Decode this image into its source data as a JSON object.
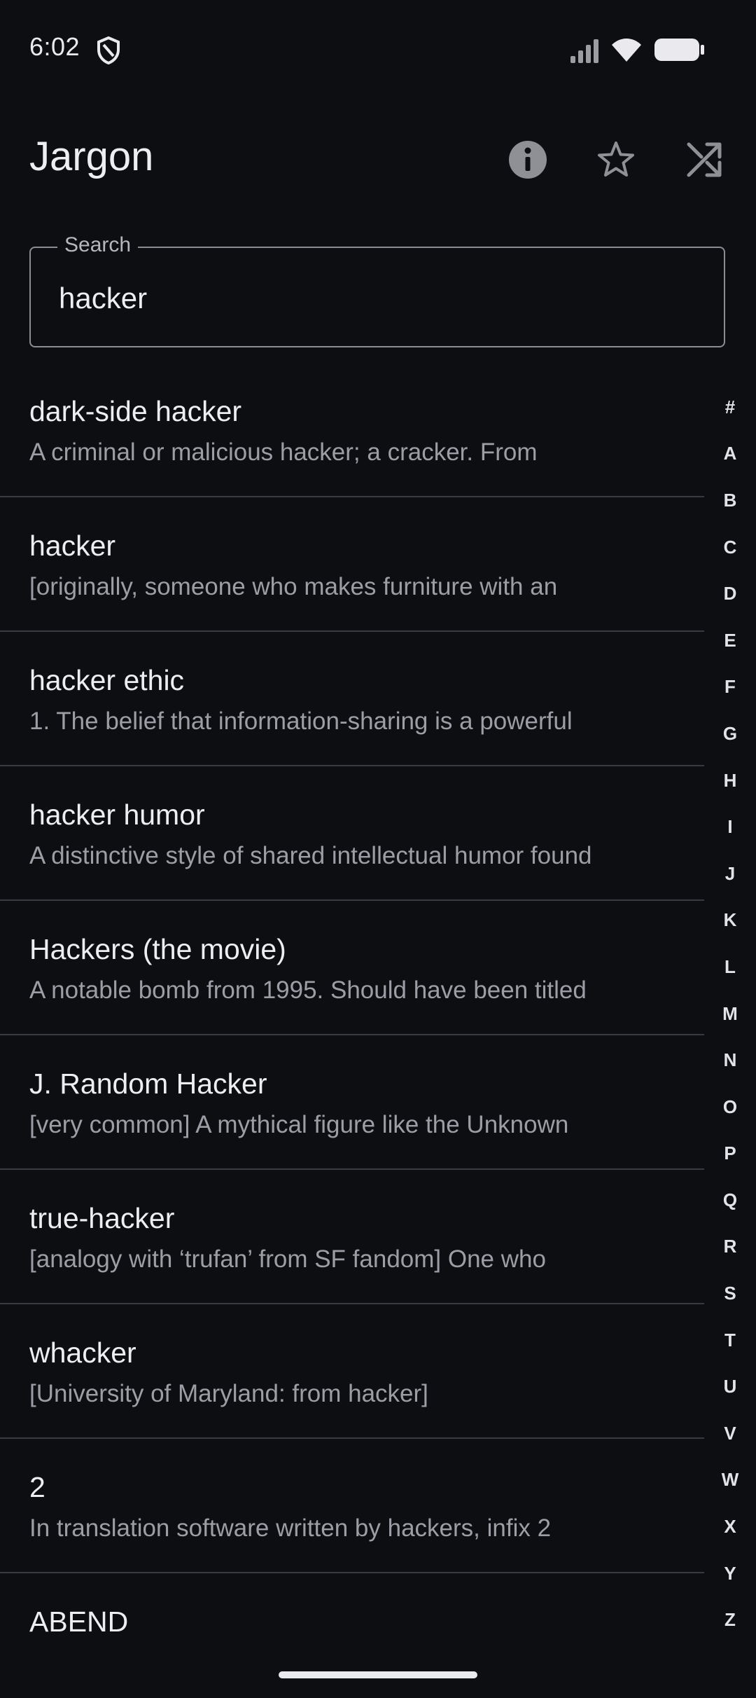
{
  "status_bar": {
    "time": "6:02",
    "icons": [
      "vpn-shield-icon",
      "cellular-signal-icon",
      "wifi-icon",
      "battery-icon"
    ]
  },
  "app_bar": {
    "title": "Jargon",
    "actions": [
      "info-icon",
      "star-outline-icon",
      "shuffle-icon"
    ]
  },
  "search": {
    "label": "Search",
    "value": "hacker"
  },
  "results": [
    {
      "term": "dark-side hacker",
      "snippet": "A criminal or malicious hacker; a cracker. From"
    },
    {
      "term": "hacker",
      "snippet": "[originally, someone who makes furniture with an"
    },
    {
      "term": "hacker ethic",
      "snippet": "1. The belief that information-sharing is a powerful"
    },
    {
      "term": "hacker humor",
      "snippet": "A distinctive style of shared intellectual humor found"
    },
    {
      "term": "Hackers (the movie)",
      "snippet": "A notable bomb from 1995. Should have been titled"
    },
    {
      "term": "J. Random Hacker",
      "snippet": "[very common] A mythical figure like the Unknown"
    },
    {
      "term": "true-hacker",
      "snippet": "[analogy with ‘trufan’ from SF fandom] One who"
    },
    {
      "term": "whacker",
      "snippet": "[University of Maryland: from hacker]"
    },
    {
      "term": "2",
      "snippet": "In translation software written by hackers, infix 2"
    },
    {
      "term": "ABEND",
      "snippet": ""
    }
  ],
  "alphabet_index": [
    "#",
    "A",
    "B",
    "C",
    "D",
    "E",
    "F",
    "G",
    "H",
    "I",
    "J",
    "K",
    "L",
    "M",
    "N",
    "O",
    "P",
    "Q",
    "R",
    "S",
    "T",
    "U",
    "V",
    "W",
    "X",
    "Y",
    "Z"
  ],
  "colors": {
    "background": "#0d0e12",
    "text_primary": "#eceef2",
    "text_secondary": "#9d9ea5",
    "divider": "#3a3b40",
    "outline": "#8c8d93"
  }
}
